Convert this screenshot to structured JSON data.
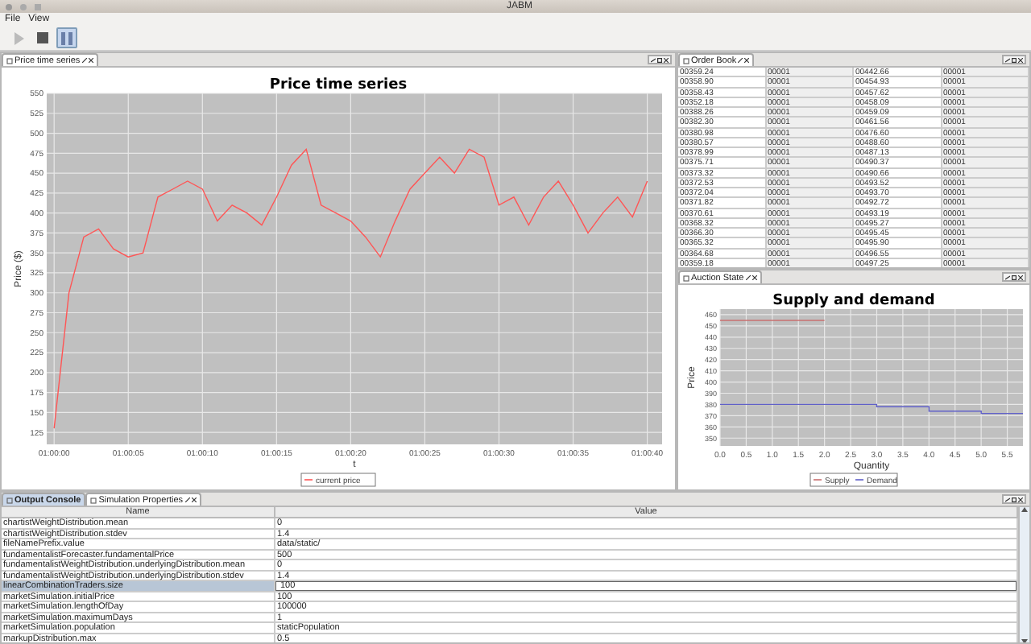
{
  "window": {
    "title": "JABM"
  },
  "menu": [
    {
      "label": "File"
    },
    {
      "label": "View"
    }
  ],
  "toolbar": [
    {
      "kind": "play",
      "disabled": true,
      "selected": false
    },
    {
      "kind": "stop",
      "disabled": false,
      "selected": false
    },
    {
      "kind": "pause",
      "disabled": false,
      "selected": true
    }
  ],
  "price_panel": {
    "tabs": [
      {
        "label": "Price time series",
        "selected": true
      }
    ],
    "chart_data": {
      "type": "line",
      "title": "Price time series",
      "xlabel": "t",
      "ylabel": "Price ($)",
      "categories": [
        "01:00:00",
        null,
        null,
        null,
        null,
        "01:00:05",
        null,
        null,
        null,
        null,
        "01:00:10",
        null,
        null,
        null,
        null,
        "01:00:15",
        null,
        null,
        null,
        null,
        "01:00:20",
        null,
        null,
        null,
        null,
        "01:00:25",
        null,
        null,
        null,
        null,
        "01:00:30",
        null,
        null,
        null,
        null,
        "01:00:35",
        null,
        null,
        null,
        null,
        "01:00:40"
      ],
      "series": [
        {
          "name": "current price",
          "color": "#ff5555",
          "values": [
            130,
            300,
            370,
            380,
            355,
            345,
            350,
            420,
            430,
            440,
            430,
            390,
            410,
            400,
            385,
            420,
            460,
            480,
            410,
            400,
            390,
            370,
            345,
            390,
            430,
            450,
            470,
            450,
            480,
            470,
            410,
            420,
            385,
            420,
            440,
            410,
            375,
            400,
            420,
            395,
            440
          ]
        }
      ],
      "ylim": [
        110,
        550
      ],
      "grid": true,
      "legend": true,
      "yticks": [
        125,
        150,
        175,
        200,
        225,
        250,
        275,
        300,
        325,
        350,
        375,
        400,
        425,
        450,
        475,
        500,
        525,
        550
      ]
    }
  },
  "order_book": {
    "tabs": [
      {
        "label": "Order Book",
        "selected": true
      }
    ],
    "rows": [
      [
        "00359.24",
        "00001",
        "00442.66",
        "00001"
      ],
      [
        "00358.90",
        "00001",
        "00454.93",
        "00001"
      ],
      [
        "00358.43",
        "00001",
        "00457.62",
        "00001"
      ],
      [
        "00352.18",
        "00001",
        "00458.09",
        "00001"
      ],
      [
        "00388.26",
        "00001",
        "00459.09",
        "00001"
      ],
      [
        "00382.30",
        "00001",
        "00461.56",
        "00001"
      ],
      [
        "00380.98",
        "00001",
        "00476.60",
        "00001"
      ],
      [
        "00380.57",
        "00001",
        "00488.60",
        "00001"
      ],
      [
        "00378.99",
        "00001",
        "00487.13",
        "00001"
      ],
      [
        "00375.71",
        "00001",
        "00490.37",
        "00001"
      ],
      [
        "00373.32",
        "00001",
        "00490.66",
        "00001"
      ],
      [
        "00372.53",
        "00001",
        "00493.52",
        "00001"
      ],
      [
        "00372.04",
        "00001",
        "00493.70",
        "00001"
      ],
      [
        "00371.82",
        "00001",
        "00492.72",
        "00001"
      ],
      [
        "00370.61",
        "00001",
        "00493.19",
        "00001"
      ],
      [
        "00368.32",
        "00001",
        "00495.27",
        "00001"
      ],
      [
        "00366.30",
        "00001",
        "00495.45",
        "00001"
      ],
      [
        "00365.32",
        "00001",
        "00495.90",
        "00001"
      ],
      [
        "00364.68",
        "00001",
        "00496.55",
        "00001"
      ],
      [
        "00359.18",
        "00001",
        "00497.25",
        "00001"
      ]
    ]
  },
  "auction_panel": {
    "tabs": [
      {
        "label": "Auction State",
        "selected": true
      }
    ],
    "chart_data": {
      "type": "line",
      "title": "Supply and demand",
      "xlabel": "Quantity",
      "ylabel": "Price",
      "x": [
        0,
        2,
        3,
        3,
        4,
        4,
        5,
        5,
        5.8
      ],
      "series": [
        {
          "name": "Supply",
          "color": "#c87070",
          "values": [
            455,
            455,
            null,
            null,
            null,
            null,
            null,
            null,
            null
          ]
        },
        {
          "name": "Demand",
          "color": "#6060c8",
          "values": [
            380,
            380,
            380,
            378,
            378,
            374,
            374,
            372,
            372
          ]
        }
      ],
      "xlim": [
        0,
        5.8
      ],
      "ylim": [
        343,
        465
      ],
      "grid": true,
      "legend": true,
      "xticks": [
        {
          "value": 0,
          "label": "0.0"
        },
        {
          "value": 0.5,
          "label": "0.5"
        },
        {
          "value": 1,
          "label": "1.0"
        },
        {
          "value": 1.5,
          "label": "1.5"
        },
        {
          "value": 2,
          "label": "2.0"
        },
        {
          "value": 2.5,
          "label": "2.5"
        },
        {
          "value": 3,
          "label": "3.0"
        },
        {
          "value": 3.5,
          "label": "3.5"
        },
        {
          "value": 4,
          "label": "4.0"
        },
        {
          "value": 4.5,
          "label": "4.5"
        },
        {
          "value": 5,
          "label": "5.0"
        },
        {
          "value": 5.5,
          "label": "5.5"
        }
      ],
      "yticks": [
        350,
        360,
        370,
        380,
        390,
        400,
        410,
        420,
        430,
        440,
        450,
        460
      ]
    }
  },
  "properties_panel": {
    "tabs": [
      {
        "label": "Output Console",
        "selected": false
      },
      {
        "label": "Simulation Properties",
        "selected": true
      }
    ],
    "columns": [
      "Name",
      "Value"
    ],
    "rows": [
      {
        "name": "chartistWeightDistribution.mean",
        "value": "0",
        "selected": false
      },
      {
        "name": "chartistWeightDistribution.stdev",
        "value": "1.4",
        "selected": false
      },
      {
        "name": "fileNamePrefix.value",
        "value": "data/static/",
        "selected": false
      },
      {
        "name": "fundamentalistForecaster.fundamentalPrice",
        "value": "500",
        "selected": false
      },
      {
        "name": "fundamentalistWeightDistribution.underlyingDistribution.mean",
        "value": "0",
        "selected": false
      },
      {
        "name": "fundamentalistWeightDistribution.underlyingDistribution.stdev",
        "value": "1.4",
        "selected": false
      },
      {
        "name": "linearCombinationTraders.size",
        "value": "100",
        "selected": true
      },
      {
        "name": "marketSimulation.initialPrice",
        "value": "100",
        "selected": false
      },
      {
        "name": "marketSimulation.lengthOfDay",
        "value": "100000",
        "selected": false
      },
      {
        "name": "marketSimulation.maximumDays",
        "value": "1",
        "selected": false
      },
      {
        "name": "marketSimulation.population",
        "value": "staticPopulation",
        "selected": false
      },
      {
        "name": "markupDistribution.max",
        "value": "0.5",
        "selected": false
      }
    ]
  }
}
